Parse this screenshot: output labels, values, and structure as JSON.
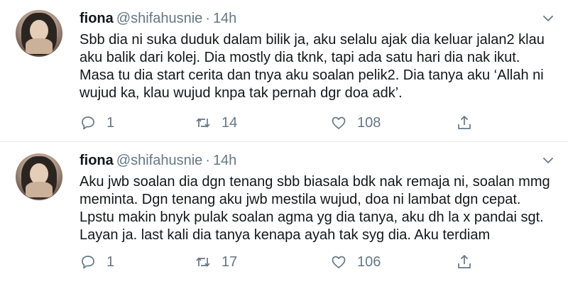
{
  "tweets": [
    {
      "author": {
        "display_name": "fiona",
        "handle": "@shifahusnie",
        "separator": "·",
        "time": "14h"
      },
      "text_lines": [
        "Sbb dia ni suka duduk dalam bilik ja, aku selalu ajak dia keluar jalan2 klau",
        "aku balik dari kolej. Dia mostly dia tknk, tapi ada satu hari dia nak ikut.",
        "Masa tu dia start cerita dan tnya aku soalan pelik2. Dia tanya aku ‘Allah ni",
        "wujud ka, klau wujud knpa tak pernah dgr doa adk’."
      ],
      "stats": {
        "replies": "1",
        "retweets": "14",
        "likes": "108"
      }
    },
    {
      "author": {
        "display_name": "fiona",
        "handle": "@shifahusnie",
        "separator": "·",
        "time": "14h"
      },
      "text_lines": [
        "Aku jwb soalan dia dgn tenang sbb biasala bdk nak remaja ni, soalan mmg",
        "meminta. Dgn tenang aku jwb mestila wujud, doa ni lambat dgn cepat.",
        "Lpstu makin bnyk pulak soalan agma yg dia tanya, aku dh la x pandai sgt.",
        "Layan ja. last kali dia tanya kenapa ayah tak syg dia. Aku terdiam"
      ],
      "stats": {
        "replies": "1",
        "retweets": "17",
        "likes": "106"
      }
    }
  ],
  "icons": {
    "reply": "reply-icon",
    "retweet": "retweet-icon",
    "like": "heart-icon",
    "share": "share-icon",
    "menu": "chevron-down-icon"
  },
  "colors": {
    "text": "#14171a",
    "secondary": "#657786",
    "divider": "#e6ecf0"
  }
}
